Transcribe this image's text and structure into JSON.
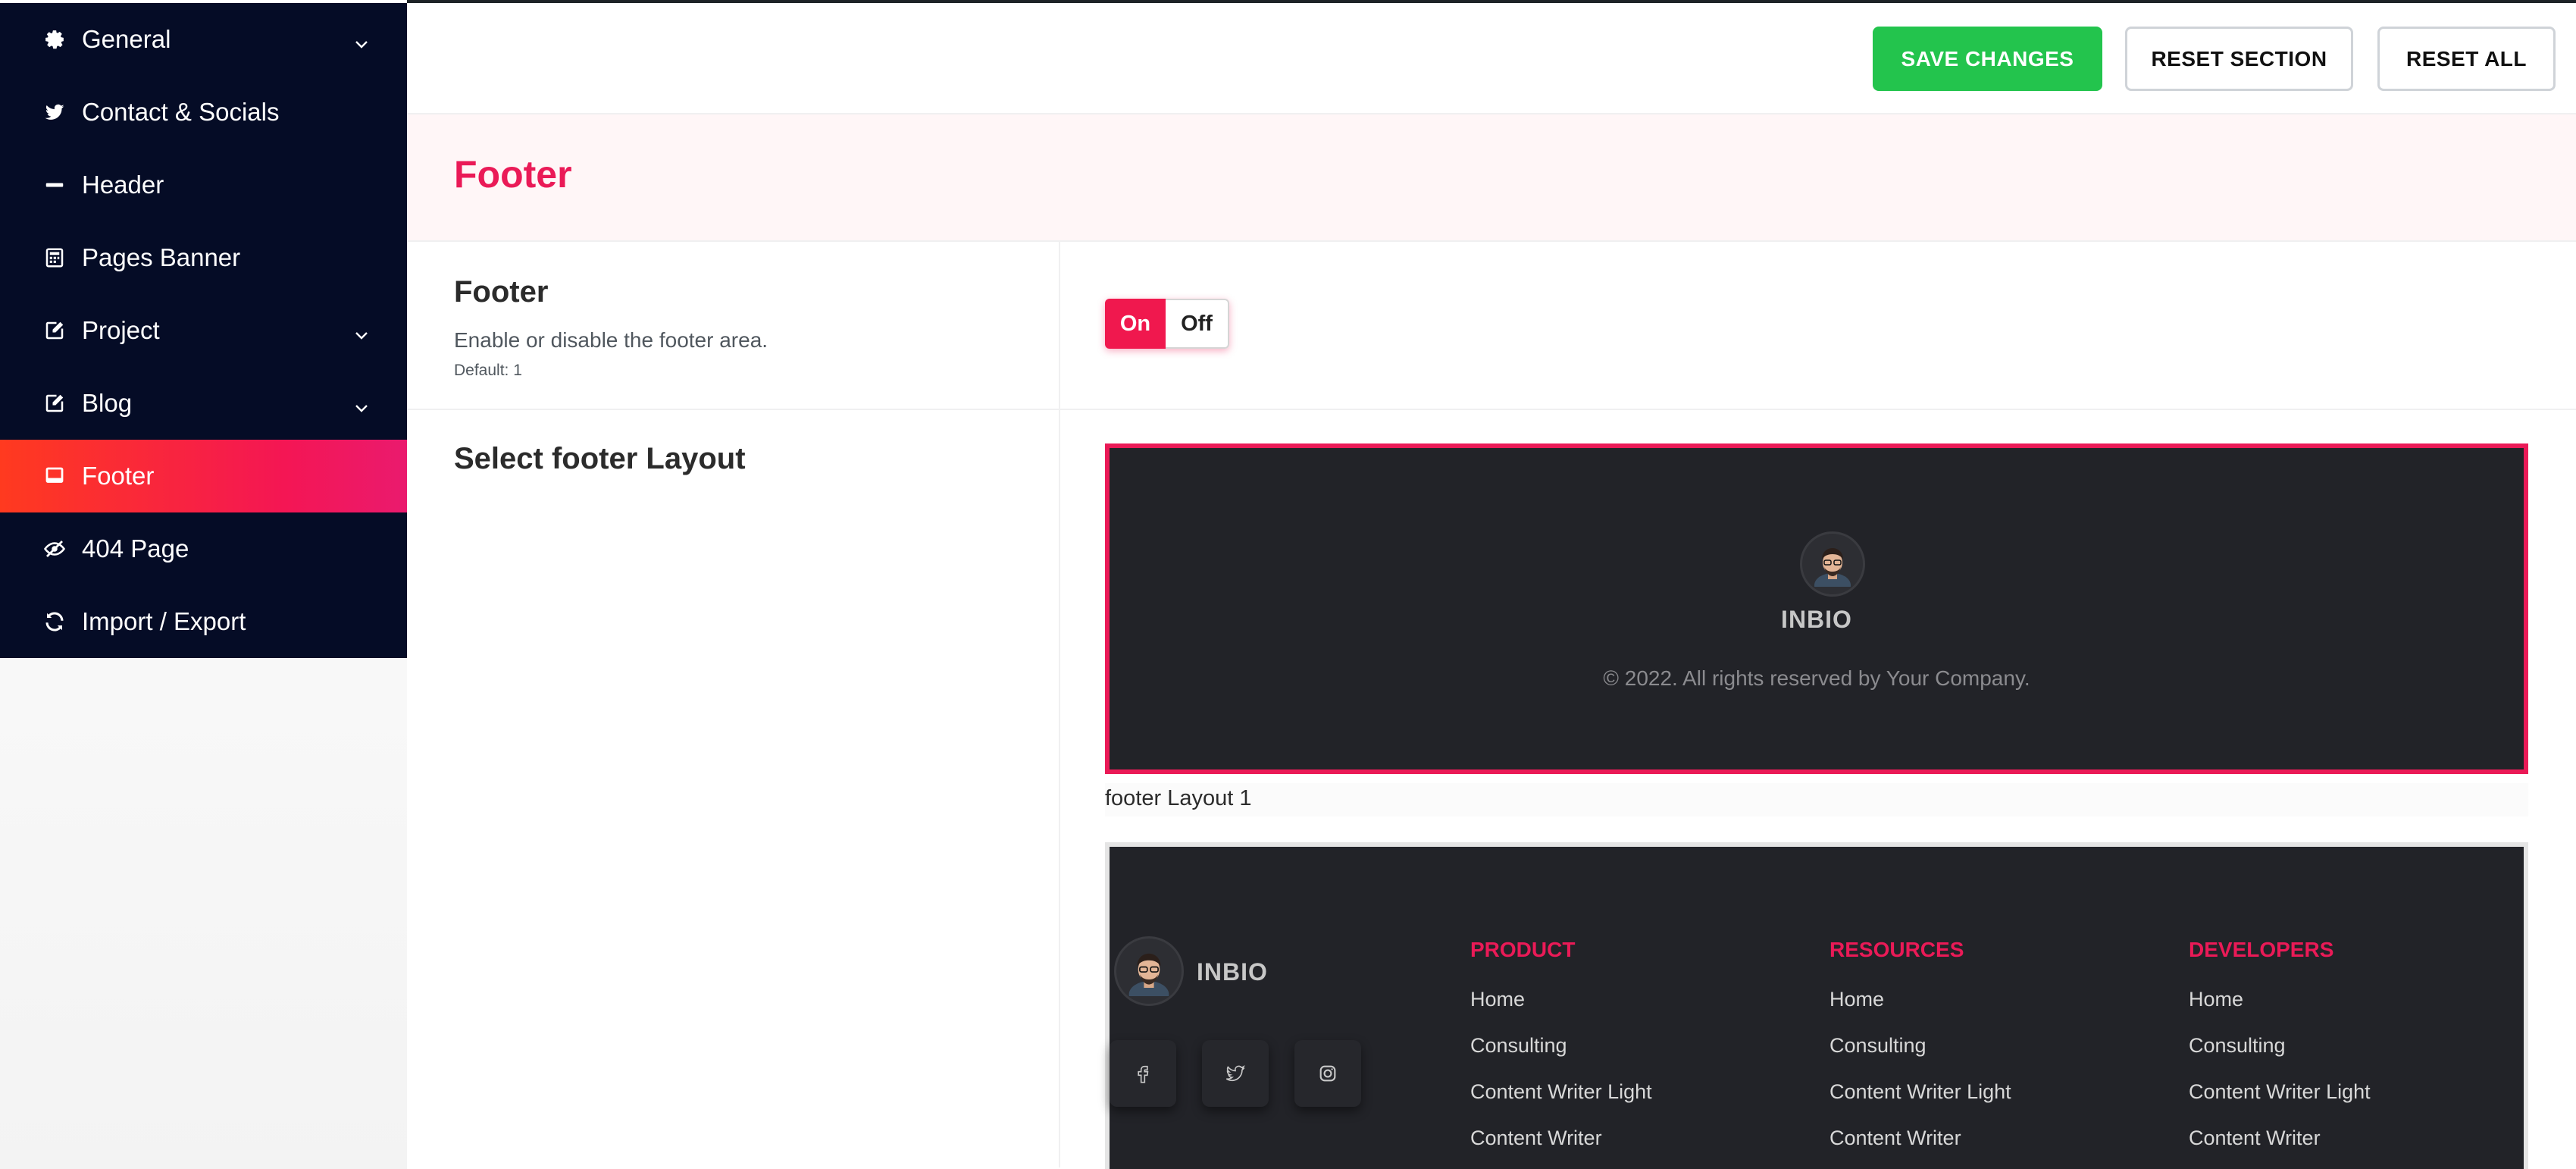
{
  "sidebar": {
    "items": [
      {
        "label": "General",
        "icon": "gear-icon",
        "has_submenu": true,
        "active": false
      },
      {
        "label": "Contact & Socials",
        "icon": "twitter-icon",
        "has_submenu": false,
        "active": false
      },
      {
        "label": "Header",
        "icon": "minus-icon",
        "has_submenu": false,
        "active": false
      },
      {
        "label": "Pages Banner",
        "icon": "calculator-icon",
        "has_submenu": false,
        "active": false
      },
      {
        "label": "Project",
        "icon": "edit-icon",
        "has_submenu": true,
        "active": false
      },
      {
        "label": "Blog",
        "icon": "edit-icon",
        "has_submenu": true,
        "active": false
      },
      {
        "label": "Footer",
        "icon": "laptop-icon",
        "has_submenu": false,
        "active": true
      },
      {
        "label": "404 Page",
        "icon": "hidden-eye-icon",
        "has_submenu": false,
        "active": false
      },
      {
        "label": "Import / Export",
        "icon": "refresh-icon",
        "has_submenu": false,
        "active": false
      }
    ]
  },
  "toolbar": {
    "save_label": "SAVE CHANGES",
    "reset_section_label": "RESET SECTION",
    "reset_all_label": "RESET ALL"
  },
  "section": {
    "title": "Footer"
  },
  "footer_toggle": {
    "title": "Footer",
    "description": "Enable or disable the footer area.",
    "default_text": "Default: 1",
    "on_label": "On",
    "off_label": "Off",
    "value": "On"
  },
  "layout_select": {
    "title": "Select footer Layout",
    "layouts": [
      {
        "caption": "footer Layout 1",
        "selected": true,
        "brand": "INBIO",
        "copyright": "© 2022. All rights reserved by Your Company."
      },
      {
        "caption": "",
        "selected": false,
        "brand": "INBIO",
        "socials": [
          "facebook-icon",
          "twitter-icon",
          "instagram-icon"
        ],
        "columns": [
          {
            "heading": "PRODUCT",
            "links": [
              "Home",
              "Consulting",
              "Content Writer Light",
              "Content Writer"
            ]
          },
          {
            "heading": "RESOURCES",
            "links": [
              "Home",
              "Consulting",
              "Content Writer Light",
              "Content Writer"
            ]
          },
          {
            "heading": "DEVELOPERS",
            "links": [
              "Home",
              "Consulting",
              "Content Writer Light",
              "Content Writer"
            ]
          }
        ]
      }
    ]
  },
  "colors": {
    "sidebar_bg": "#050c26",
    "accent": "#ea1a57",
    "save_green": "#23c44d",
    "preview_bg": "#222328"
  }
}
